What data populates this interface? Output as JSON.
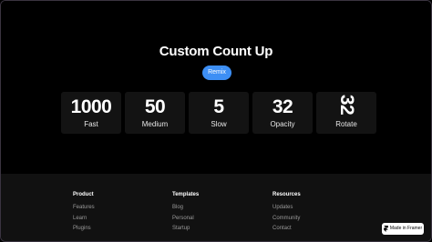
{
  "hero": {
    "title": "Custom Count Up",
    "button_label": "Remix",
    "accent_color": "#3d8ff5"
  },
  "counters": [
    {
      "value": "1000",
      "label": "Fast"
    },
    {
      "value": "50",
      "label": "Medium"
    },
    {
      "value": "5",
      "label": "Slow"
    },
    {
      "value": "32",
      "label": "Opacity"
    },
    {
      "value": "32",
      "label": "Rotate"
    }
  ],
  "footer": {
    "columns": [
      {
        "heading": "Product",
        "links": [
          "Features",
          "Learn",
          "Plugins"
        ]
      },
      {
        "heading": "Templates",
        "links": [
          "Blog",
          "Personal",
          "Startup"
        ]
      },
      {
        "heading": "Resources",
        "links": [
          "Updates",
          "Community",
          "Contact"
        ]
      }
    ]
  },
  "badge": {
    "label": "Made in Framer",
    "icon": "framer-logo-icon"
  }
}
